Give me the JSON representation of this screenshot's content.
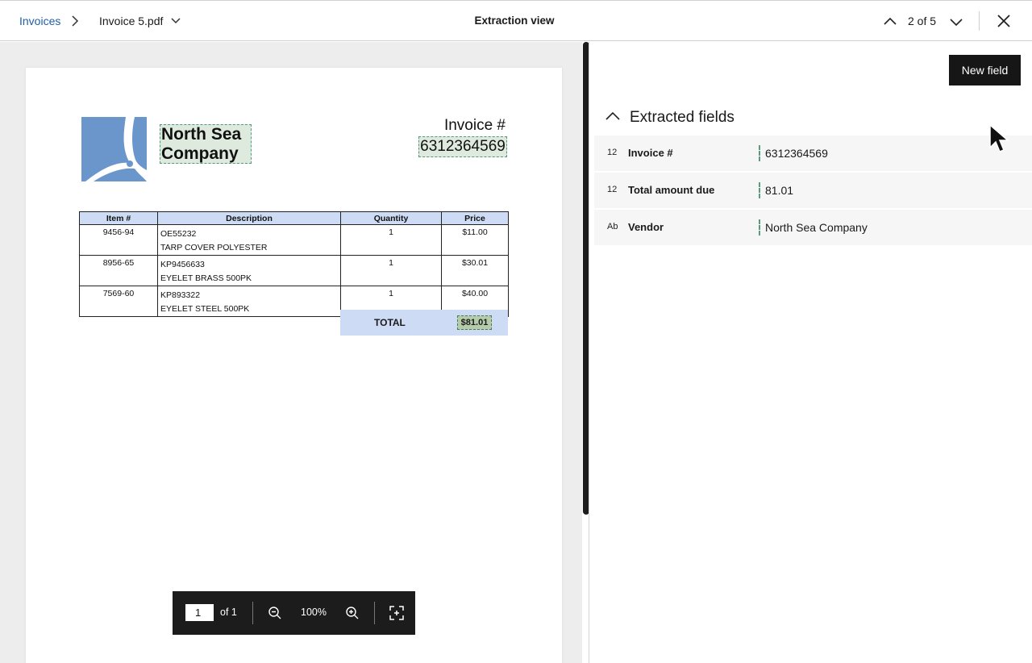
{
  "breadcrumb": {
    "root": "Invoices",
    "file": "Invoice 5.pdf"
  },
  "header": {
    "title": "Extraction view",
    "counter": "2 of 5"
  },
  "document": {
    "company_line1": "North Sea",
    "company_line2": "Company",
    "invoice_label": "Invoice #",
    "invoice_number": "6312364569",
    "table": {
      "headers": [
        "Item #",
        "Description",
        "Quantity",
        "Price"
      ],
      "rows": [
        {
          "item": "9456-94",
          "code": "OE55232",
          "desc": "TARP COVER POLYESTER",
          "qty": "1",
          "price": "$11.00"
        },
        {
          "item": "8956-65",
          "code": "KP9456633",
          "desc": "EYELET BRASS 500PK",
          "qty": "1",
          "price": "$30.01"
        },
        {
          "item": "7569-60",
          "code": "KP893322",
          "desc": "EYELET STEEL 500PK",
          "qty": "1",
          "price": "$40.00"
        }
      ],
      "total_label": "TOTAL",
      "total_value": "$81.01"
    },
    "logo_color": "#6a96cc"
  },
  "zoombar": {
    "page": "1",
    "page_of": "of 1",
    "zoom": "100%"
  },
  "panel": {
    "new_field_label": "New field",
    "section_title": "Extracted fields",
    "fields": [
      {
        "type": "12",
        "label": "Invoice #",
        "value": "6312364569"
      },
      {
        "type": "12",
        "label": "Total amount due",
        "value": "81.01"
      },
      {
        "type": "Ab",
        "label": "Vendor",
        "value": "North Sea Company"
      }
    ]
  },
  "colors": {
    "link": "#1f5fa8",
    "highlight": "#dfeadf",
    "highlight_border": "#4e9a7a",
    "table_header": "#cddcf4",
    "dark_button": "#161616"
  }
}
